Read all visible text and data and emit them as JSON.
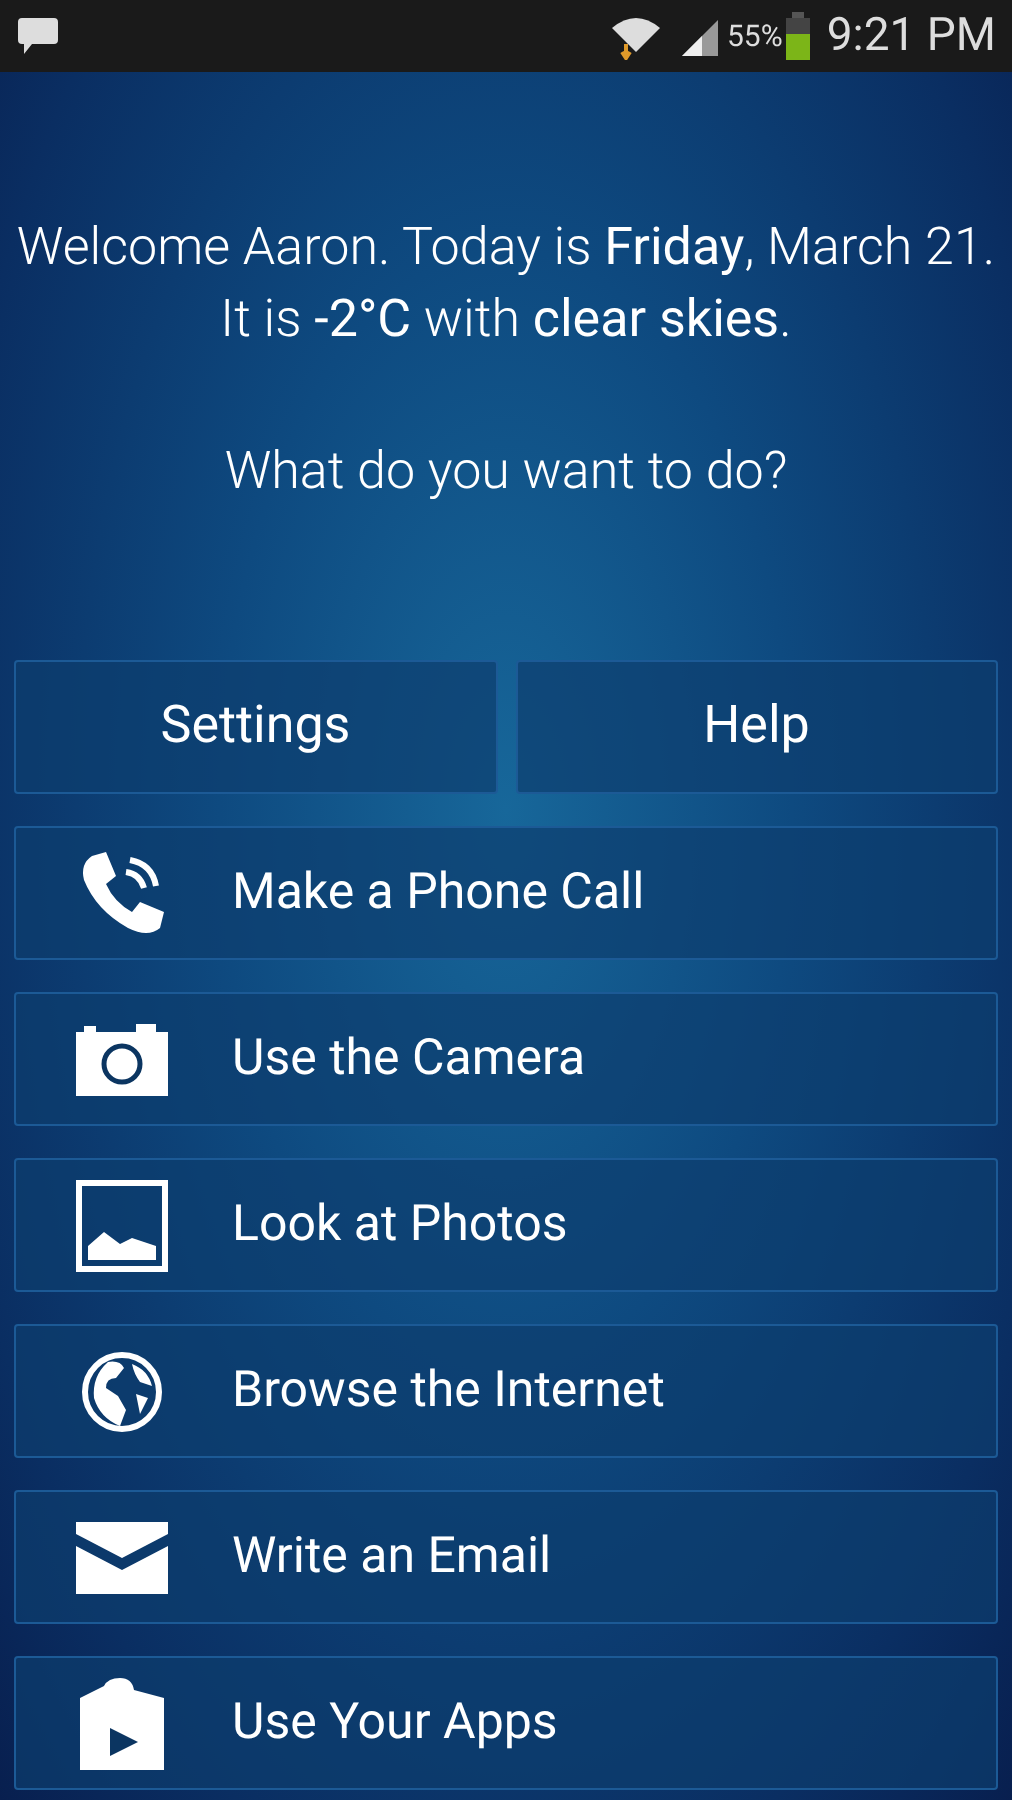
{
  "status_bar": {
    "battery": "55%",
    "time": "9:21 PM"
  },
  "welcome": "Welcome Aaron. Today is **Friday**, March 21. It is **-2°C** with **clear skies**.",
  "question": "What do you want to do?",
  "top_buttons": [
    "Settings",
    "Help"
  ],
  "actions": [
    {
      "kind": "phone",
      "label": "Make a Phone Call"
    },
    {
      "kind": "camera",
      "label": "Use the Camera"
    },
    {
      "kind": "photos",
      "label": "Look at Photos"
    },
    {
      "kind": "globe",
      "label": "Browse the Internet"
    },
    {
      "kind": "email",
      "label": "Write an Email"
    },
    {
      "kind": "apps",
      "label": "Use Your Apps"
    }
  ]
}
